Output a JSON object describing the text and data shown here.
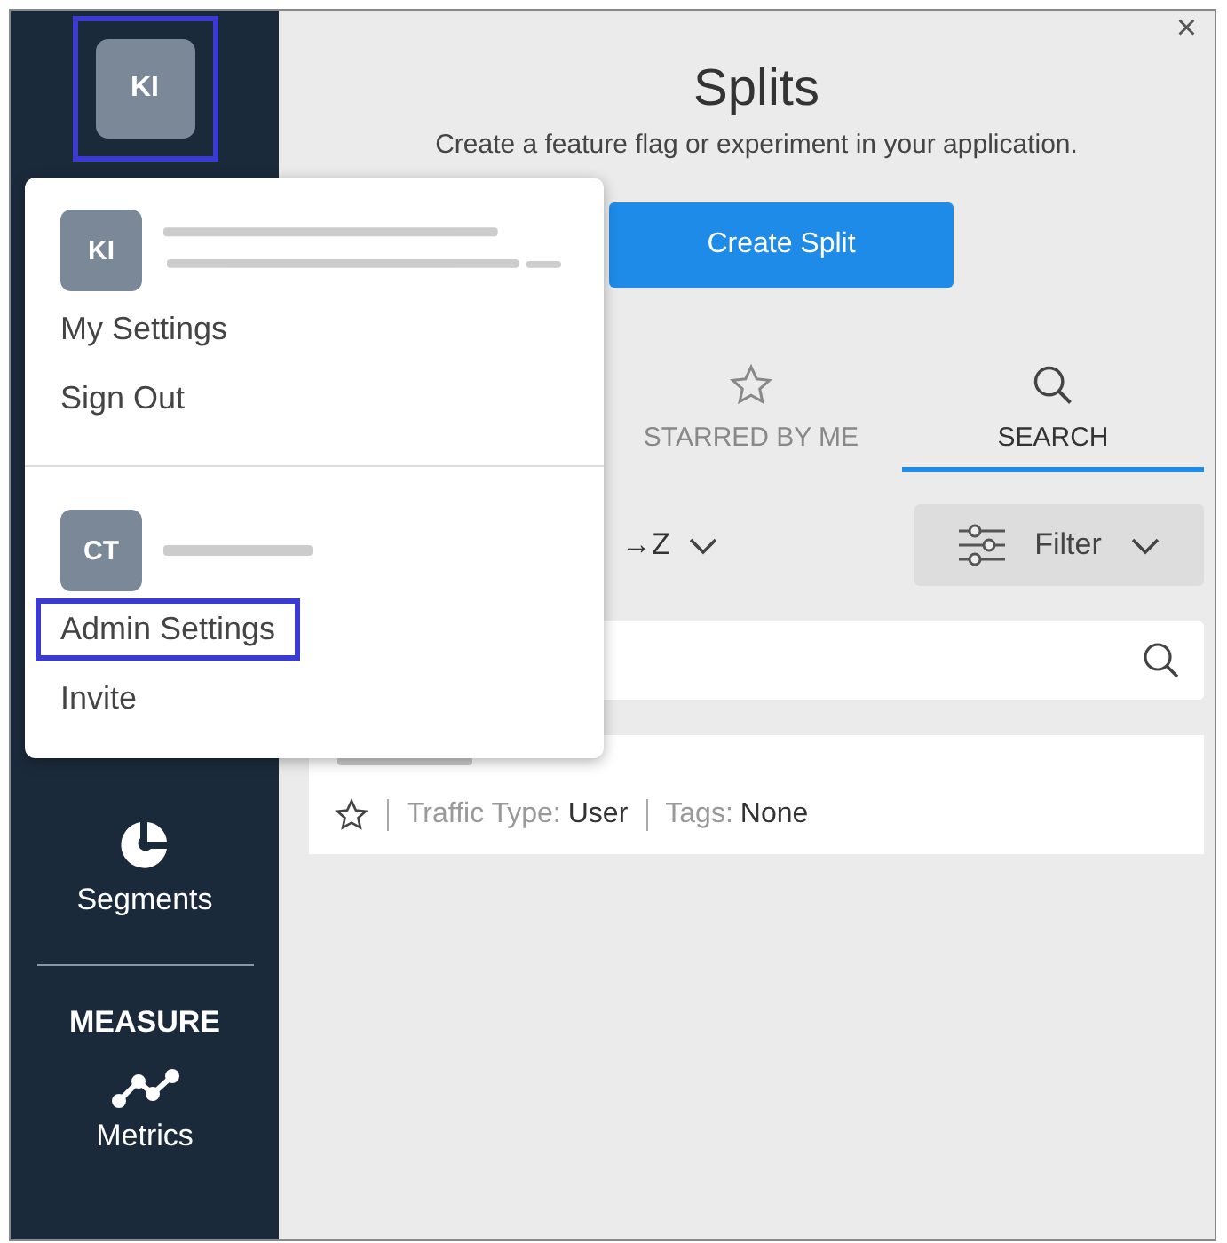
{
  "sidebar": {
    "avatar": {
      "initials": "KI",
      "highlighted": true
    },
    "items": [
      {
        "label": "Segments",
        "kind": "segments"
      }
    ],
    "section": "MEASURE",
    "section_items": [
      {
        "label": "Metrics",
        "kind": "metrics"
      }
    ]
  },
  "header": {
    "close": "×",
    "title": "Splits",
    "subtitle": "Create a feature flag or experiment in your application.",
    "create_button": "Create Split"
  },
  "tabs": [
    {
      "label": "STARRED BY ME",
      "kind": "star",
      "selected": false
    },
    {
      "label": "SEARCH",
      "kind": "search",
      "selected": true
    }
  ],
  "sort": {
    "label": "→Z"
  },
  "filter": {
    "label": "Filter"
  },
  "splits": [
    {
      "starred": false,
      "traffic_type_label": "Traffic Type:",
      "traffic_type": "User",
      "tags_label": "Tags:",
      "tags": "None"
    }
  ],
  "menu": {
    "user": {
      "initials": "KI"
    },
    "items": [
      {
        "label": "My Settings",
        "highlighted": false
      },
      {
        "label": "Sign Out",
        "highlighted": false
      }
    ],
    "org": {
      "initials": "CT"
    },
    "org_items": [
      {
        "label": "Admin Settings",
        "highlighted": true
      },
      {
        "label": "Invite",
        "highlighted": false
      }
    ]
  }
}
